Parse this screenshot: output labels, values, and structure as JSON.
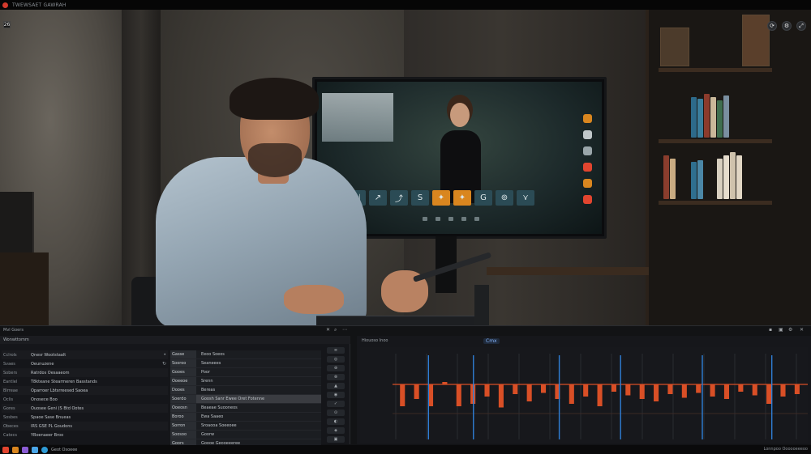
{
  "window": {
    "title": "TWEWSAET GAWRAH",
    "corner_badge": "26",
    "accent": "#d33a2c"
  },
  "video_controls": {
    "right_buttons": [
      "refresh-icon",
      "settings-icon",
      "expand-icon"
    ]
  },
  "screen_toolbar": {
    "buttons": [
      "⤡",
      "⇲",
      "↗",
      "⤴",
      "S",
      "✦",
      "✦",
      "G",
      "⊚",
      "⋎"
    ],
    "highlight_color": "#d9861f"
  },
  "panel": {
    "title": "Mvl Goers",
    "tab_label": "Wonwttomm",
    "list_a": [
      {
        "k": "Cclrols",
        "v": "Qnesr Wootstaalt",
        "ic": "•"
      },
      {
        "k": "Svaes",
        "v": "Oeunuzene",
        "ic": "↻"
      },
      {
        "k": "Sobers",
        "v": "Ratrdos Oesaaeom",
        "ic": ""
      },
      {
        "k": "Eantlel",
        "v": "T8kteane Stearmeren Basstands",
        "ic": ""
      },
      {
        "k": "Blrreae",
        "v": "Oparroer Lbtsrreesed Saoea",
        "ic": ""
      },
      {
        "k": "Oclis",
        "v": "Onosece Boo",
        "ic": ""
      },
      {
        "k": "Gores",
        "v": "Ouosee Geni (S Btd Ootes",
        "ic": ""
      },
      {
        "k": "Sosbes",
        "v": "Spaoe Sase Bnueas",
        "ic": ""
      },
      {
        "k": "Obeces",
        "v": "IRS GSE PL Goudons",
        "ic": ""
      },
      {
        "k": "Catecs",
        "v": "YBoenaeer Broo",
        "ic": ""
      }
    ],
    "list_b": [
      {
        "k": "Gasse",
        "v": "Eeoo Soeos"
      },
      {
        "k": "Sooroo",
        "v": "Seaneees"
      },
      {
        "k": "Gooes",
        "v": "Poor"
      },
      {
        "k": "Ooeeoe",
        "v": "Srenn"
      },
      {
        "k": "Dooes",
        "v": "Bereas"
      },
      {
        "k": "Soerdo",
        "v": "Goosh Sanr Ewee Oret Fotenne"
      },
      {
        "k": "Ooeosn",
        "v": "Beaeae Suooneos"
      },
      {
        "k": "Boroo",
        "v": "Ewa Saaeo"
      },
      {
        "k": "Sorron",
        "v": "Sroaooa Soeeoee"
      },
      {
        "k": "Soosoo",
        "v": "Goorw"
      },
      {
        "k": "Goors",
        "v": "Goooe Geooeeeree"
      }
    ],
    "selected_row_b": 5,
    "mini_buttons": [
      "≡",
      "◎",
      "⊕",
      "⊗",
      "▲",
      "◉",
      "✓",
      "⊙",
      "◐",
      "◈",
      "▣",
      "⊞"
    ]
  },
  "scope": {
    "header_label": "Hiouoso Inoo",
    "badge": "Cmx",
    "axis_labels": [
      "Ananar Shil",
      "Bnoaoo",
      "Sooe",
      "Oaeee"
    ],
    "line_color": "#d94f26",
    "marker_color": "#2f7fd6",
    "pulse_values": [
      -0.9,
      -0.6,
      -0.9,
      0.1,
      -0.9,
      -0.8,
      -0.5,
      -0.95,
      -0.4,
      -0.7,
      -0.35,
      -0.6,
      -0.8,
      -0.5,
      -0.9,
      -0.3,
      -0.45,
      -0.6,
      -0.7,
      -0.4,
      -0.55,
      -0.35,
      -0.5,
      -0.6,
      -0.3,
      -0.45,
      -0.8,
      -0.5,
      -0.4
    ]
  },
  "taskbar": {
    "label": "Geot Osoeee",
    "right_text": "Lonnpoo Oooooeeeoo",
    "icons": [
      "#e2452f",
      "#d9861f",
      "#8a5cd4",
      "#4aa6e8",
      "#2e9bd6"
    ]
  }
}
